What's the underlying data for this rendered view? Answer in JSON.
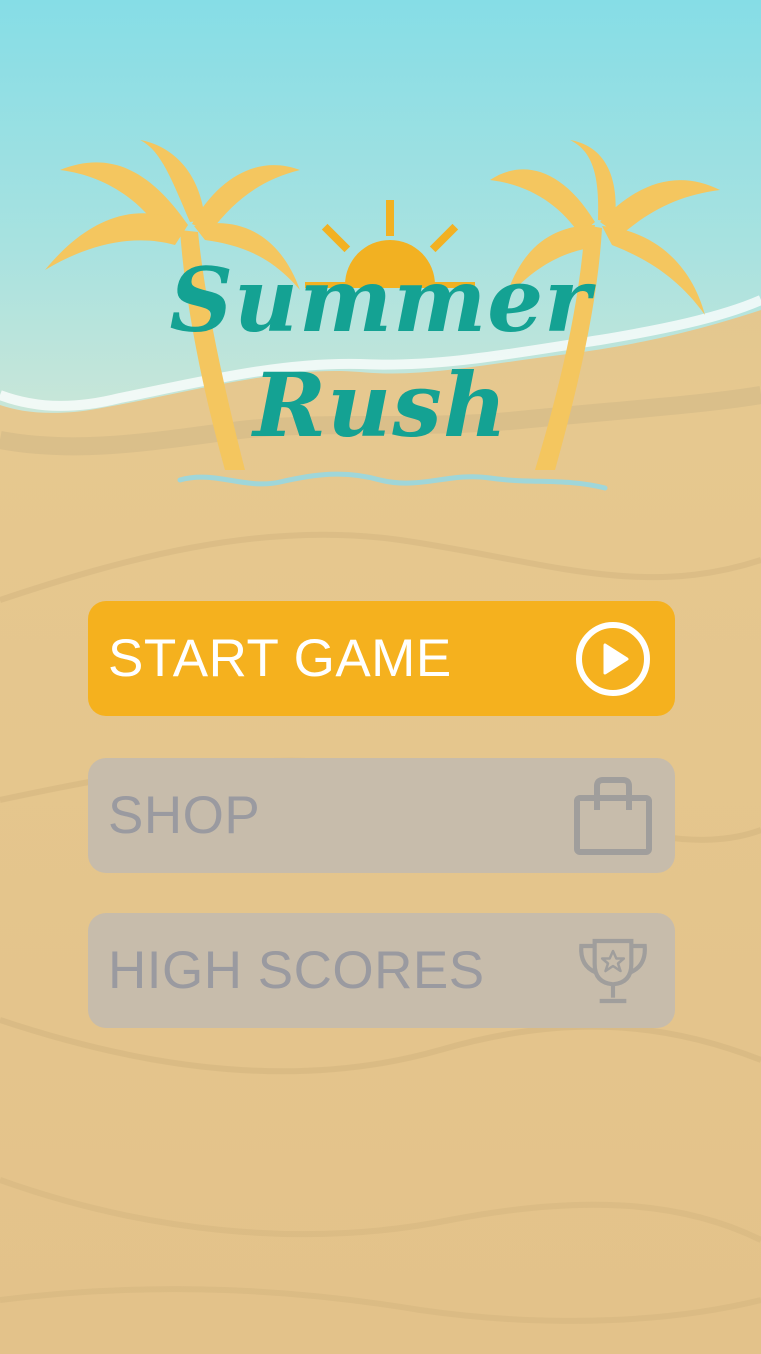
{
  "app": {
    "title_line_1": "Summer",
    "title_line_2": "Rush"
  },
  "menu": {
    "start_label": "START GAME",
    "start_icon": "play-circle-icon",
    "shop_label": "SHOP",
    "shop_icon": "shopping-bag-icon",
    "scores_label": "HIGH SCORES",
    "scores_icon": "trophy-icon"
  },
  "colors": {
    "sea": "#7fd8e0",
    "sand": "#e6c78e",
    "title": "#14a293",
    "palm": "#f4c65f",
    "sun": "#f2b122",
    "start_button": "#f5b11e",
    "disabled_button": "#c7bcab",
    "disabled_text": "#9a9aa0"
  }
}
